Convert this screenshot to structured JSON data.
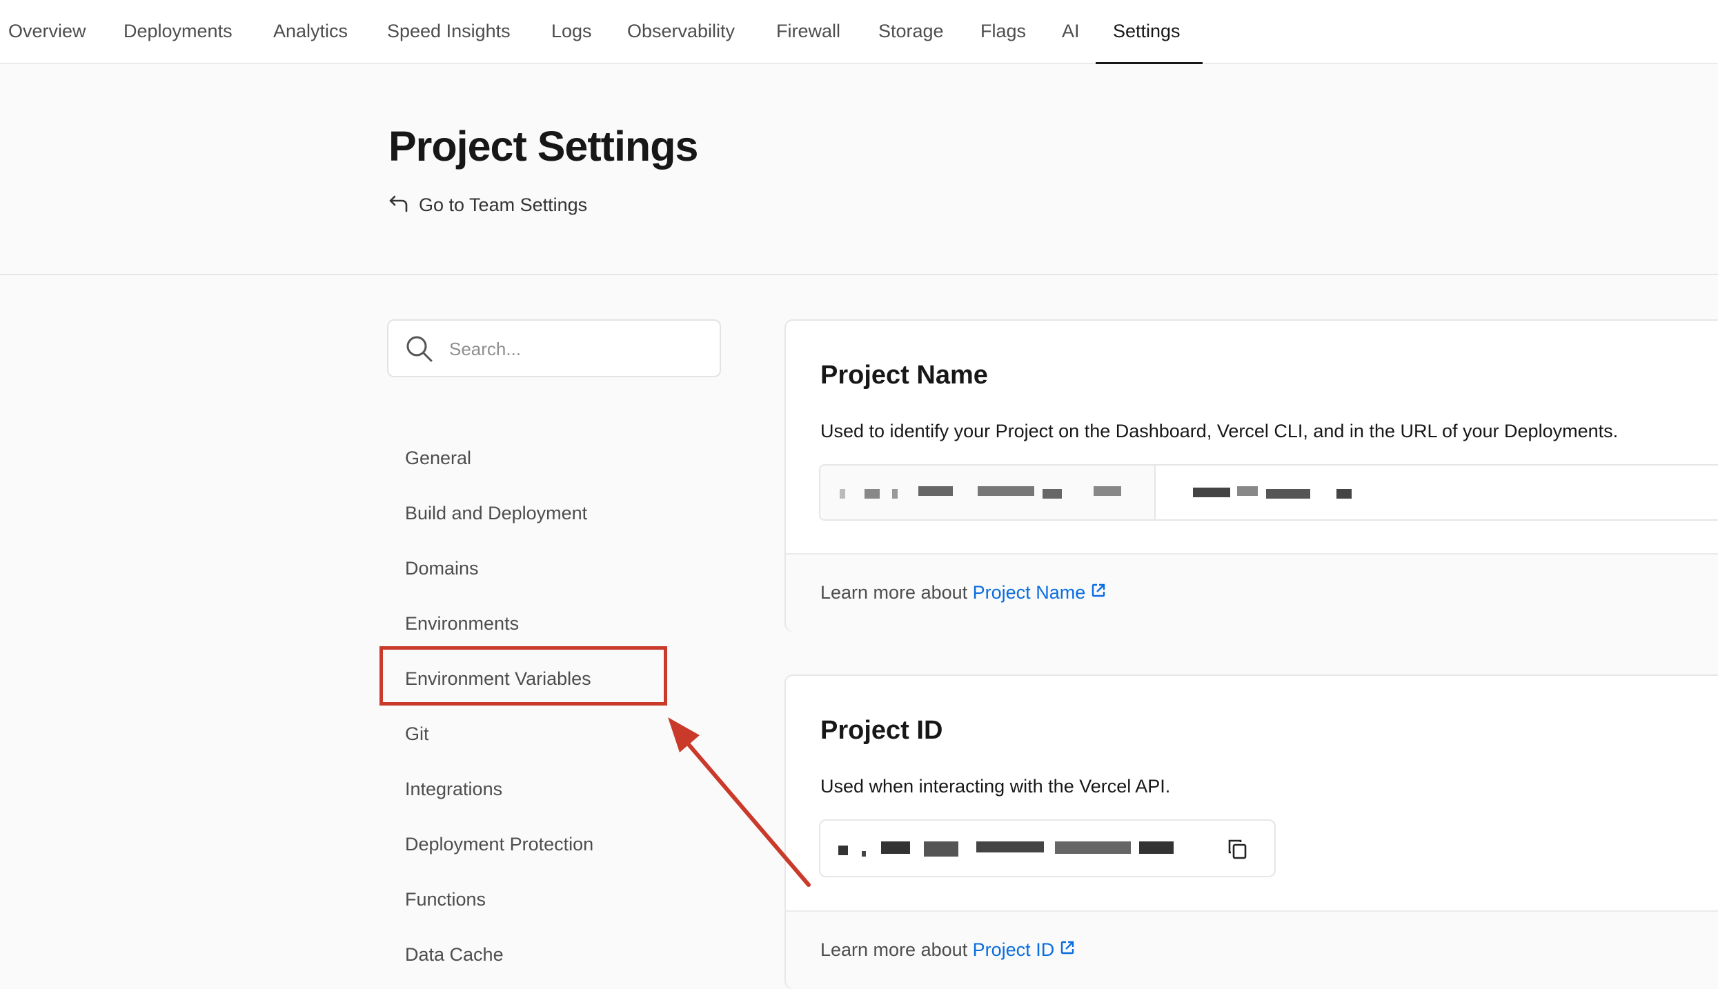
{
  "nav": {
    "tabs": [
      {
        "label": "Overview"
      },
      {
        "label": "Deployments"
      },
      {
        "label": "Analytics"
      },
      {
        "label": "Speed Insights"
      },
      {
        "label": "Logs"
      },
      {
        "label": "Observability"
      },
      {
        "label": "Firewall"
      },
      {
        "label": "Storage"
      },
      {
        "label": "Flags"
      },
      {
        "label": "AI"
      },
      {
        "label": "Settings"
      }
    ],
    "active_tab": "Settings"
  },
  "header": {
    "title": "Project Settings",
    "back_link": "Go to Team Settings"
  },
  "search": {
    "placeholder": "Search..."
  },
  "sidebar": {
    "items": [
      {
        "label": "General"
      },
      {
        "label": "Build and Deployment"
      },
      {
        "label": "Domains"
      },
      {
        "label": "Environments"
      },
      {
        "label": "Environment Variables"
      },
      {
        "label": "Git"
      },
      {
        "label": "Integrations"
      },
      {
        "label": "Deployment Protection"
      },
      {
        "label": "Functions"
      },
      {
        "label": "Data Cache"
      }
    ],
    "highlighted_item": "Environment Variables"
  },
  "project_name_card": {
    "title": "Project Name",
    "description": "Used to identify your Project on the Dashboard, Vercel CLI, and in the URL of your Deployments.",
    "learn_prefix": "Learn more about",
    "learn_link": "Project Name"
  },
  "project_id_card": {
    "title": "Project ID",
    "description": "Used when interacting with the Vercel API.",
    "learn_prefix": "Learn more about",
    "learn_link": "Project ID"
  },
  "colors": {
    "accent_link": "#0a6de0",
    "annotation_red": "#c93a2a"
  },
  "icons": [
    "search-icon",
    "back-arrow-icon",
    "external-link-icon",
    "copy-icon"
  ]
}
